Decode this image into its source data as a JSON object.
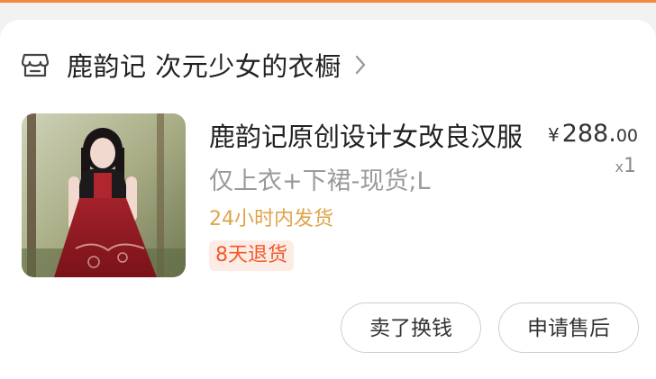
{
  "shop": {
    "name": "鹿韵记 次元少女的衣橱",
    "icon": "store-icon",
    "chevron_icon": "chevron-right-icon"
  },
  "item": {
    "title": "鹿韵记原创设计女改良汉服",
    "variant": "仅上衣+下裙-现货;L",
    "price_symbol": "¥",
    "price_int": "288.",
    "price_dec": "00",
    "qty_prefix": "x",
    "qty_value": "1",
    "shipping": "24小时内发货",
    "return_badge": "8天退货",
    "thumbnail": "product-photo-girl-in-red-hanfu"
  },
  "actions": {
    "sell_label": "卖了换钱",
    "after_sales_label": "申请售后"
  },
  "colors": {
    "accent": "#f28b3c",
    "shipping_text": "#e0a34a",
    "badge_text": "#f05a2a",
    "badge_bg": "#fdece6"
  }
}
